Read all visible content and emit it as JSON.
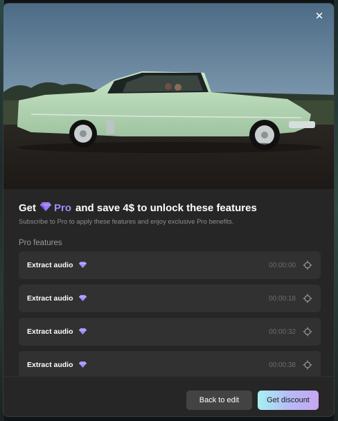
{
  "dialog": {
    "close_icon": "close-icon",
    "headline": {
      "prefix": "Get",
      "gem_icon": "diamond-icon",
      "pro_label": "Pro",
      "suffix": "and save 4$ to unlock these features"
    },
    "subtitle": "Subscribe to Pro to apply these features and enjoy exclusive Pro benefits.",
    "section_title": "Pro features",
    "features": [
      {
        "name": "Extract audio",
        "time": "00:00:00"
      },
      {
        "name": "Extract audio",
        "time": "00:00:18"
      },
      {
        "name": "Extract audio",
        "time": "00:00:32"
      },
      {
        "name": "Extract audio",
        "time": "00:00:38"
      }
    ],
    "buttons": {
      "back": "Back to edit",
      "discount": "Get discount"
    }
  },
  "colors": {
    "pro_accent": "#9d8cff",
    "dialog_bg": "#262626",
    "row_bg": "#313131",
    "discount_gradient_start": "#a7f0f2",
    "discount_gradient_end": "#c7a6f3"
  }
}
